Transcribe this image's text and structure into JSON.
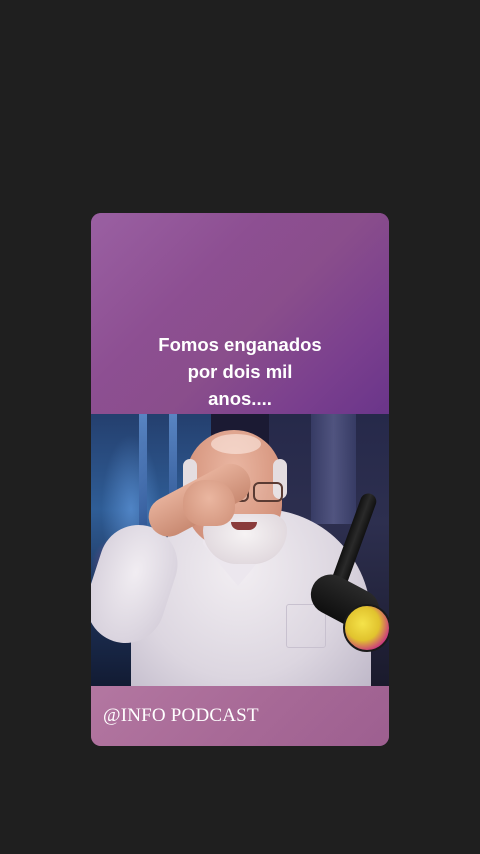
{
  "story": {
    "caption_lines": [
      "Fomos enganados",
      "por dois mil",
      "anos...."
    ],
    "footer_handle": "@INFO PODCAST"
  },
  "colors": {
    "screen_background": "#1f1f1f",
    "caption_gradient_start": "#9a60a2",
    "caption_gradient_end": "#6a358a",
    "footer_background": "#a86a97",
    "text": "#ffffff"
  },
  "media": {
    "video_subject": "man-with-beard-and-microphone-image"
  }
}
